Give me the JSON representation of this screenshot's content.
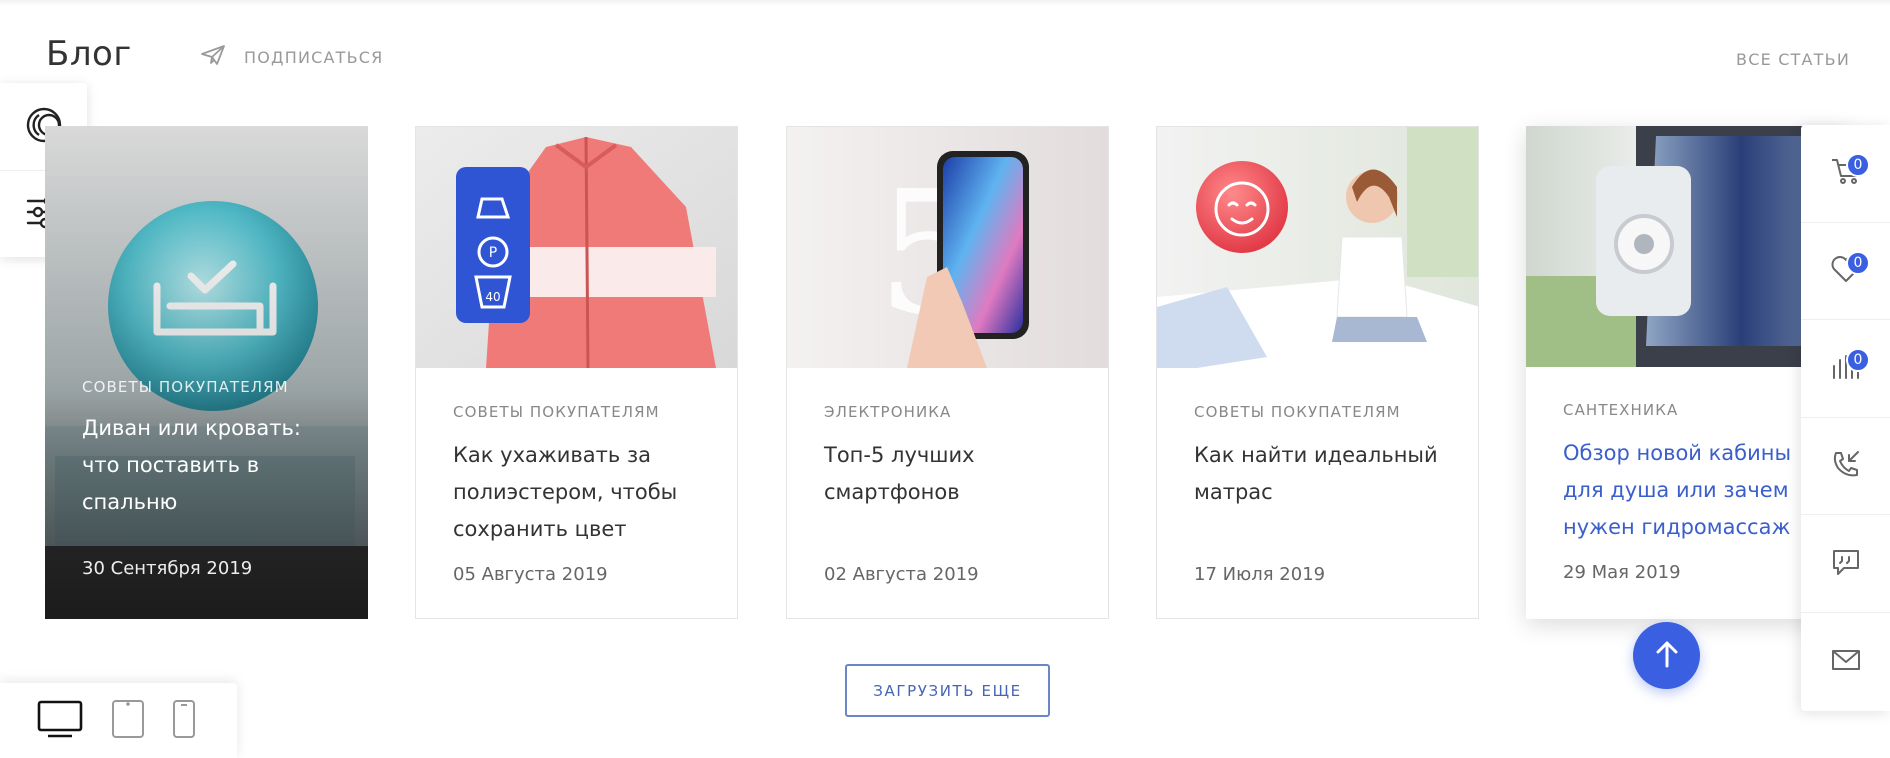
{
  "header": {
    "title": "Блог",
    "subscribe_label": "ПОДПИСАТЬСЯ",
    "all_articles_label": "ВСЕ СТАТЬИ"
  },
  "cards": [
    {
      "category": "СОВЕТЫ ПОКУПАТЕЛЯМ",
      "title": "Диван или кровать: что поставить в спальню",
      "date": "30 Сентября 2019"
    },
    {
      "category": "СОВЕТЫ ПОКУПАТЕЛЯМ",
      "title": "Как ухаживать за полиэстером, чтобы сохранить цвет",
      "date": "05 Августа 2019"
    },
    {
      "category": "ЭЛЕКТРОНИКА",
      "title": "Топ-5 лучших смартфонов",
      "date": "02 Августа 2019"
    },
    {
      "category": "СОВЕТЫ ПОКУПАТЕЛЯМ",
      "title": "Как найти идеальный матрас",
      "date": "17 Июля 2019"
    },
    {
      "category": "САНТЕХНИКА",
      "title": "Обзор новой кабины для душа или зачем нужен гидромассаж",
      "date": "29 Мая 2019"
    }
  ],
  "card_images": {
    "card2_badge": "40",
    "card3_number": "5"
  },
  "load_more_label": "ЗАГРУЗИТЬ ЕЩЕ",
  "right_panel": {
    "cart_count": "0",
    "favorites_count": "0",
    "compare_count": "0",
    "icons": [
      "cart-icon",
      "heart-icon",
      "compare-icon",
      "callback-icon",
      "chat-icon",
      "mail-icon"
    ]
  },
  "left_panel": {
    "icons": [
      "theme-icon",
      "settings-sliders-icon"
    ]
  },
  "device_switcher": {
    "icons": [
      "desktop-icon",
      "tablet-icon",
      "phone-icon"
    ],
    "selected": "desktop"
  },
  "colors": {
    "accent": "#3a5fe0",
    "link": "#3a5fcd",
    "muted": "#999999"
  }
}
